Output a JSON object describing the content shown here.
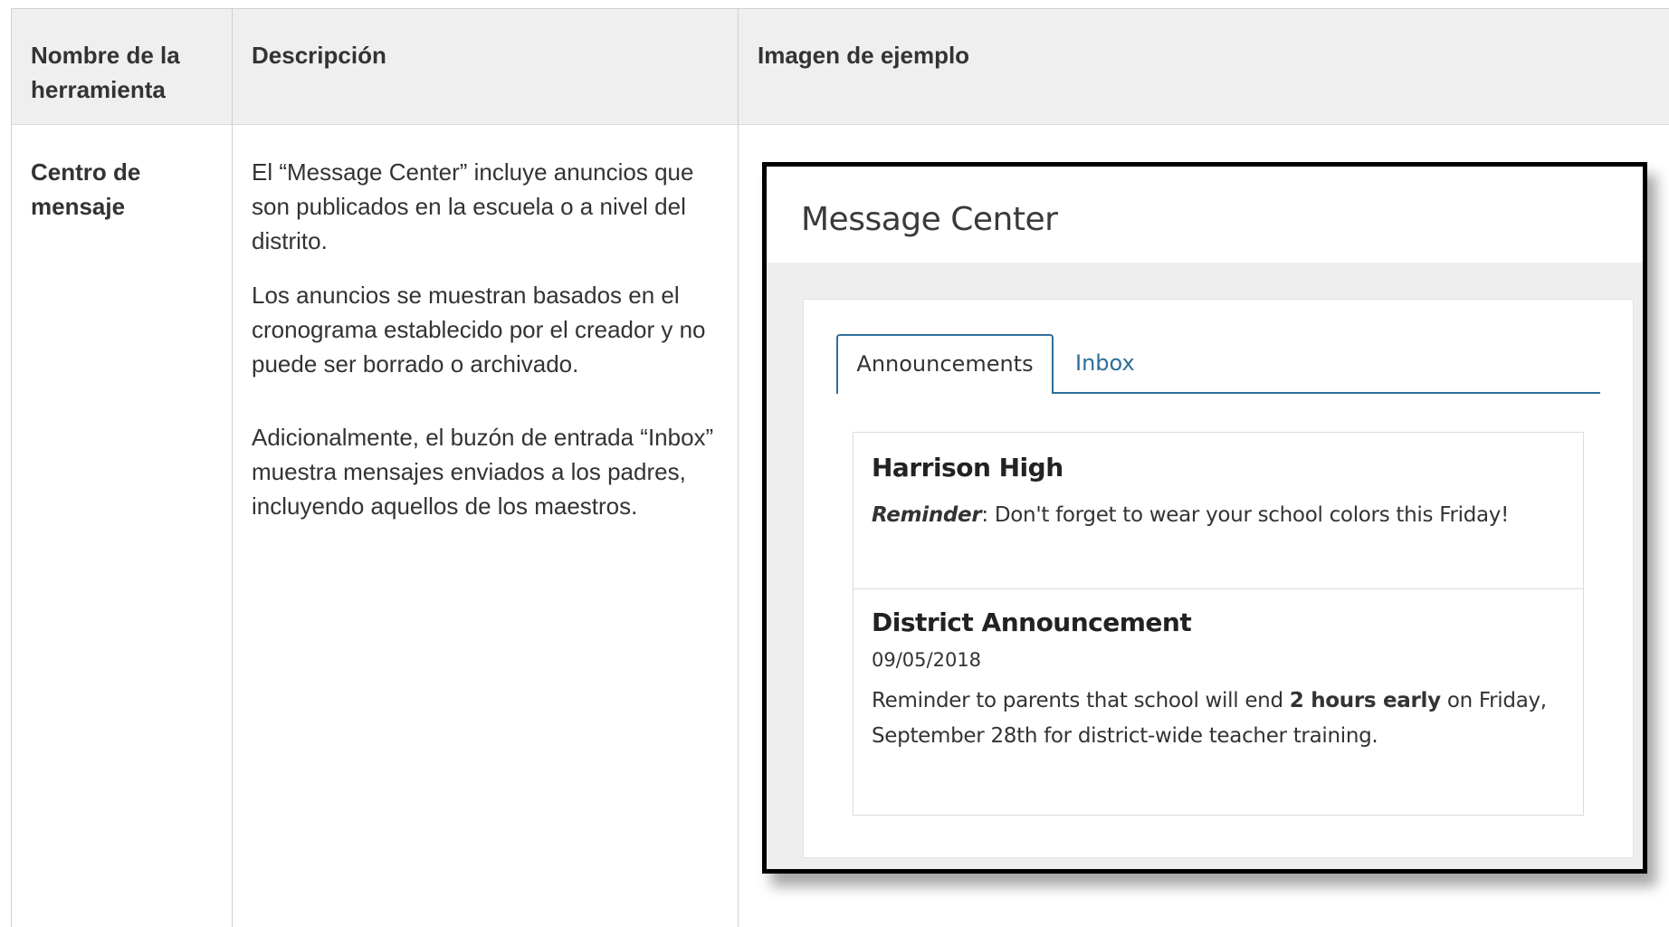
{
  "table": {
    "headers": {
      "tool_name": "Nombre de la herramienta",
      "description": "Descripción",
      "example_image": "Imagen de ejemplo"
    },
    "row": {
      "tool_name": "Centro de mensaje",
      "description_p1": "El “Message Center” incluye anuncios que son publicados en la escuela o a nivel del distrito.",
      "description_p2": "Los anuncios se muestran basados en el cronograma establecido por el creador y no puede ser borrado o archivado.",
      "description_p3": "Adicionalmente, el buzón de entrada “Inbox” muestra mensajes enviados a los padres, incluyendo aquellos de los maestros."
    }
  },
  "screenshot": {
    "title": "Message Center",
    "tabs": {
      "announcements": "Announcements",
      "inbox": "Inbox"
    },
    "announcements": [
      {
        "title": "Harrison High",
        "text_em": "Reminder",
        "text_rest": ": Don't forget to wear your school colors this Friday!"
      },
      {
        "title": "District Announcement",
        "date": "09/05/2018",
        "text_before": "Reminder to parents that school will end ",
        "text_bold": "2 hours early",
        "text_after": " on Friday, September 28th for district-wide teacher training."
      }
    ],
    "colors": {
      "accent": "#2f6e99",
      "header_bg": "#efefef"
    }
  }
}
